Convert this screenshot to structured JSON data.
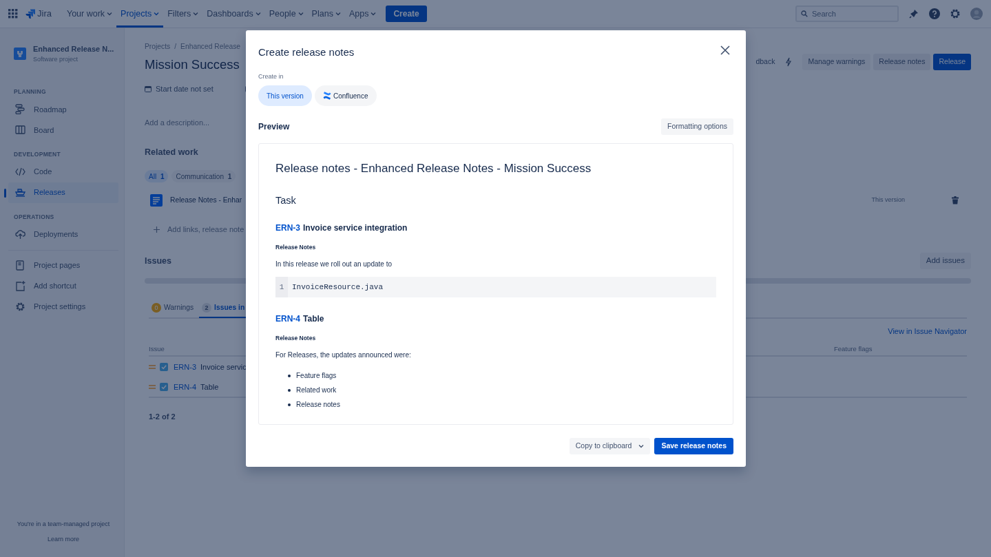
{
  "navbar": {
    "product": "Jira",
    "menu": [
      {
        "label": "Your work",
        "selected": false
      },
      {
        "label": "Projects",
        "selected": true
      },
      {
        "label": "Filters",
        "selected": false
      },
      {
        "label": "Dashboards",
        "selected": false
      },
      {
        "label": "People",
        "selected": false
      },
      {
        "label": "Plans",
        "selected": false
      },
      {
        "label": "Apps",
        "selected": false
      }
    ],
    "create_button": "Create",
    "search": {
      "placeholder": "Search"
    }
  },
  "sidebar": {
    "project": {
      "name": "Enhanced Release N...",
      "type": "Software project"
    },
    "groups": [
      {
        "heading": "PLANNING",
        "items": [
          {
            "label": "Roadmap",
            "selected": false
          },
          {
            "label": "Board",
            "selected": false
          }
        ]
      },
      {
        "heading": "DEVELOPMENT",
        "items": [
          {
            "label": "Code",
            "selected": false
          },
          {
            "label": "Releases",
            "selected": true
          }
        ]
      },
      {
        "heading": "OPERATIONS",
        "items": [
          {
            "label": "Deployments",
            "selected": false
          }
        ]
      }
    ],
    "links": [
      {
        "label": "Project pages"
      },
      {
        "label": "Add shortcut"
      },
      {
        "label": "Project settings"
      }
    ],
    "footer": {
      "text": "You're in a team-managed project",
      "link": "Learn more"
    }
  },
  "page": {
    "breadcrumbs": [
      "Projects",
      "Enhanced Release"
    ],
    "breadcrumb_separator": "/",
    "title": "Mission Success",
    "feedback": "dback",
    "actions": [
      {
        "label": "Manage warnings",
        "primary": false
      },
      {
        "label": "Release notes",
        "primary": false
      },
      {
        "label": "Release",
        "primary": true
      }
    ],
    "start_date": "Start date not set",
    "description_placeholder": "Add a description...",
    "related_work": {
      "heading": "Related work",
      "filters": [
        {
          "label": "All",
          "count": "1",
          "selected": true
        },
        {
          "label": "Communication",
          "count": "1",
          "selected": false
        }
      ],
      "items": [
        {
          "title": "Release Notes - Enhar",
          "location": "This version"
        }
      ],
      "add_link": "Add links, release note"
    },
    "issues": {
      "heading": "Issues",
      "add_button": "Add issues",
      "tabs": [
        {
          "kind": "warning",
          "count": "0",
          "label": "Warnings",
          "selected": false
        },
        {
          "kind": "issues",
          "count": "2",
          "label": "Issues in",
          "selected": true
        }
      ],
      "navigator_link": "View in Issue Navigator",
      "columns": [
        "Issue",
        "Feature flags"
      ],
      "rows": [
        {
          "key": "ERN-3",
          "summary": "Invoice servic"
        },
        {
          "key": "ERN-4",
          "summary": "Table"
        }
      ],
      "pagination": "1-2 of 2"
    }
  },
  "modal": {
    "title": "Create release notes",
    "create_in_label": "Create in",
    "destinations": [
      {
        "label": "This version",
        "selected": true
      },
      {
        "label": "Confluence",
        "selected": false
      }
    ],
    "preview_label": "Preview",
    "formatting_button": "Formatting options",
    "preview": {
      "heading": "Release notes - Enhanced Release Notes - Mission Success",
      "sections": [
        {
          "title": "Task",
          "issues": [
            {
              "key": "ERN-3",
              "summary": "Invoice service integration",
              "label": "Release Notes",
              "body": [
                {
                  "kind": "paragraph",
                  "text": "In this release we roll out an update to"
                },
                {
                  "kind": "code",
                  "lines": [
                    {
                      "number": "1",
                      "text": "InvoiceResource.java"
                    }
                  ]
                }
              ]
            },
            {
              "key": "ERN-4",
              "summary": "Table",
              "label": "Release Notes",
              "body": [
                {
                  "kind": "paragraph",
                  "text": "For Releases, the updates announced were:"
                },
                {
                  "kind": "list",
                  "items": [
                    "Feature flags",
                    "Related work",
                    "Release notes"
                  ]
                }
              ]
            }
          ]
        }
      ]
    },
    "copy_button": "Copy to clipboard",
    "save_button": "Save release notes"
  }
}
